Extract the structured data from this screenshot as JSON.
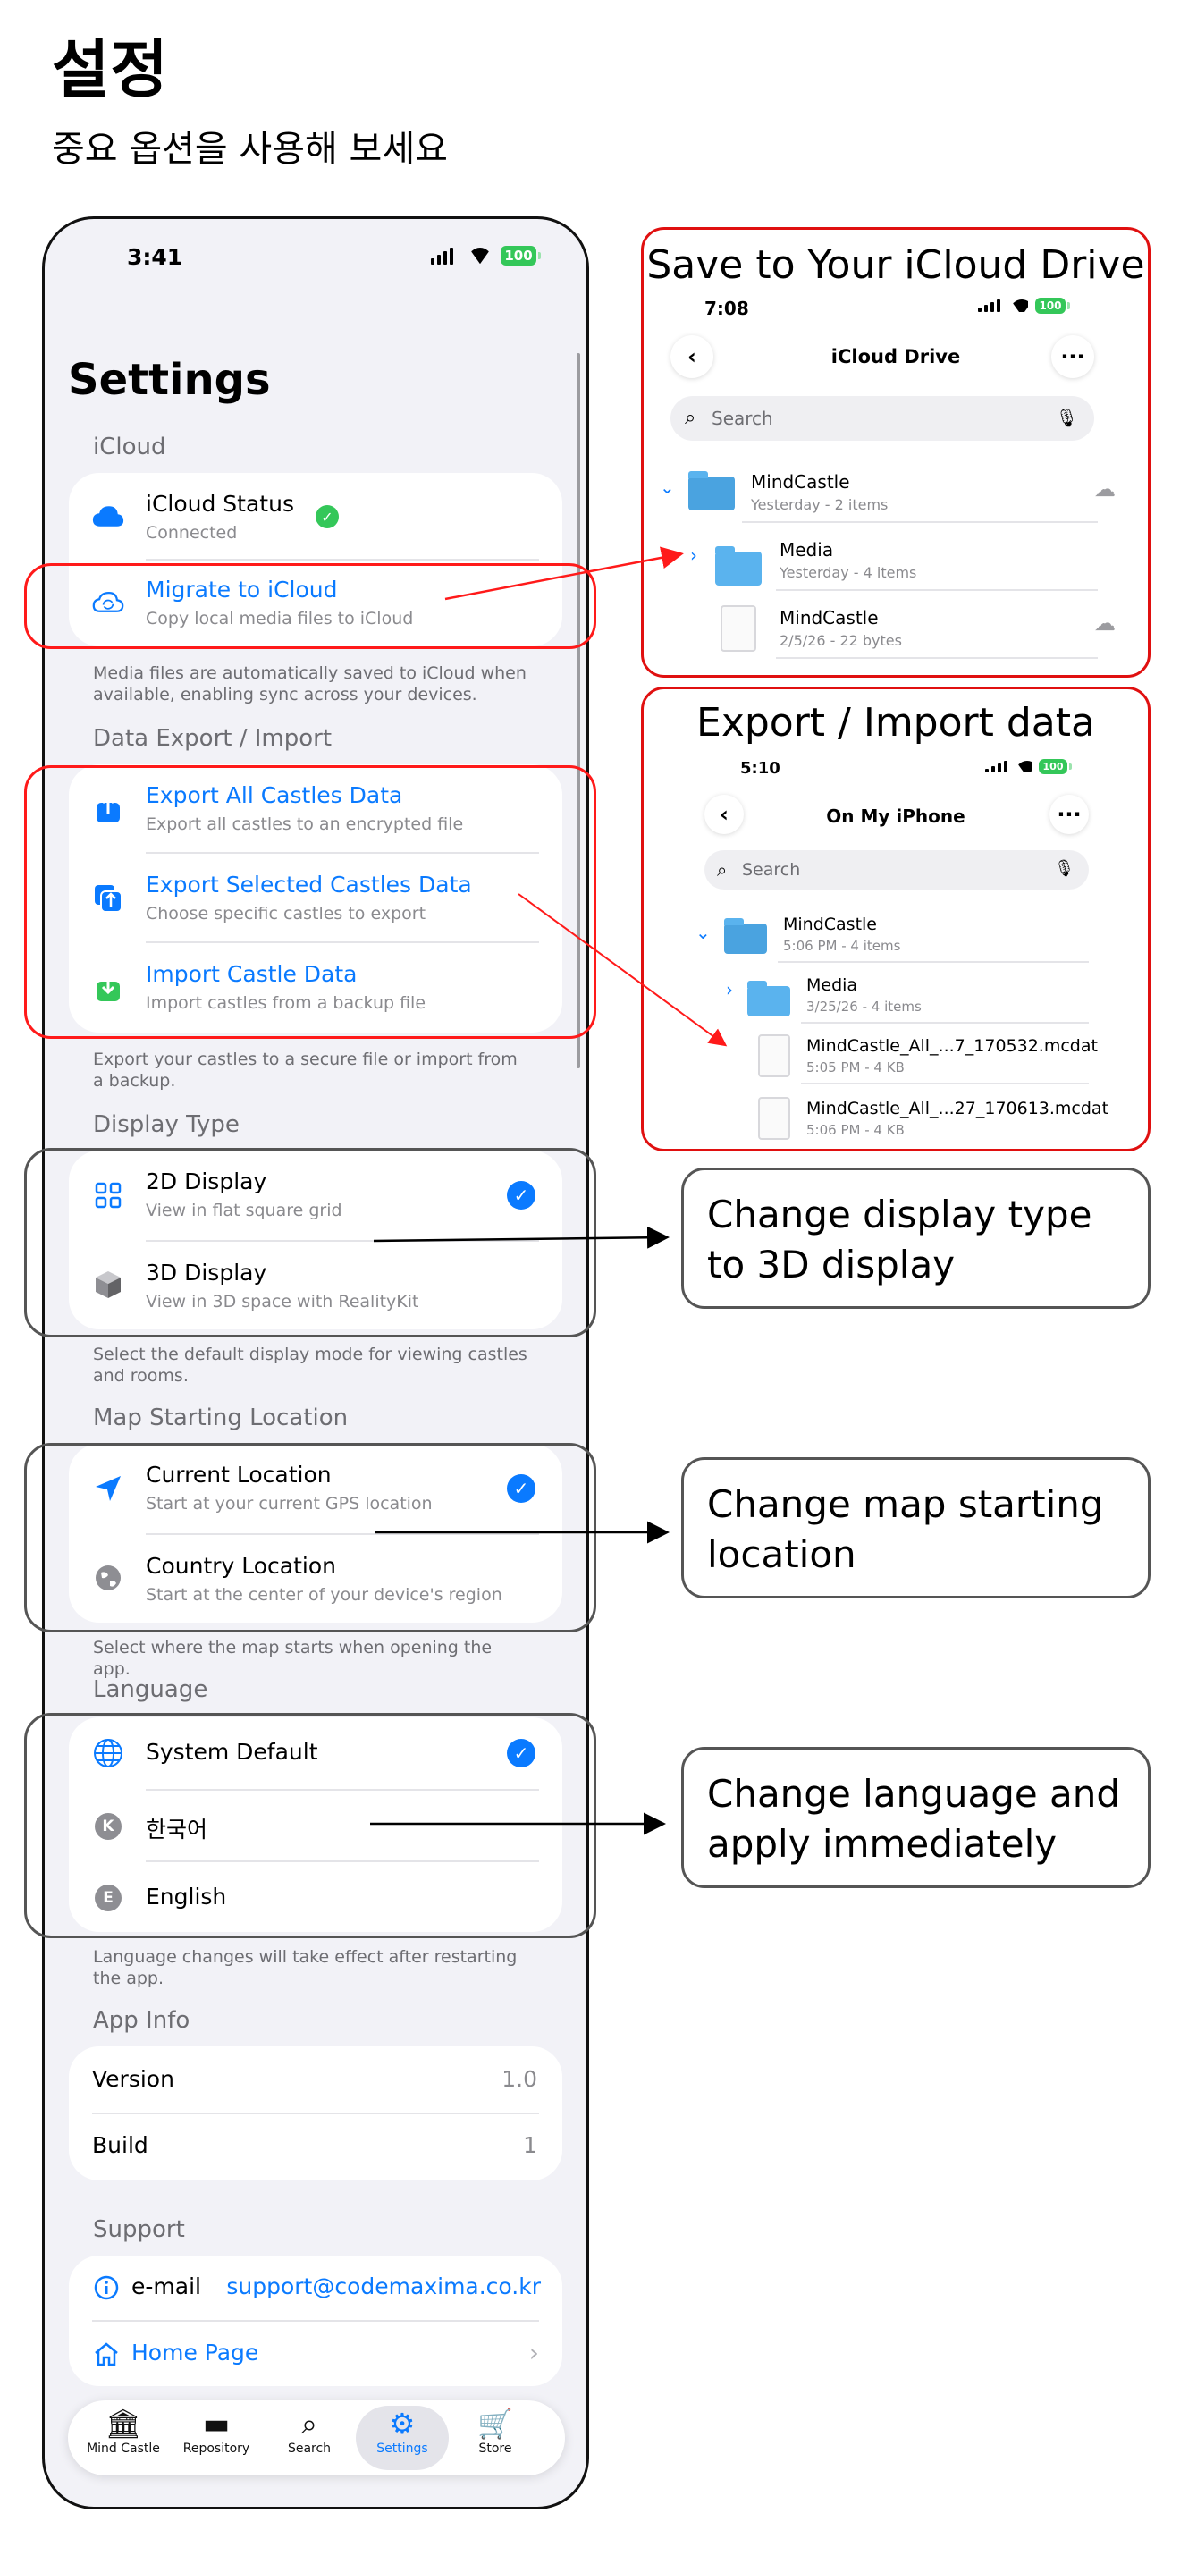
{
  "header": {
    "title": "설정",
    "subtitle": "중요 옵션을 사용해 보세요"
  },
  "phone": {
    "status": {
      "time": "3:41",
      "battery": "100"
    },
    "title": "Settings",
    "icloud": {
      "heading": "iCloud",
      "status_label": "iCloud Status",
      "status_value": "Connected",
      "migrate_label": "Migrate to iCloud",
      "migrate_sub": "Copy local media files to iCloud",
      "note": "Media files are automatically saved to iCloud when available, enabling sync across your devices."
    },
    "export": {
      "heading": "Data Export / Import",
      "items": [
        {
          "label": "Export All Castles Data",
          "sub": "Export all castles to an encrypted file"
        },
        {
          "label": "Export Selected Castles Data",
          "sub": "Choose specific castles to export"
        },
        {
          "label": "Import Castle Data",
          "sub": "Import castles from a backup file"
        }
      ],
      "note": "Export your castles to a secure file or import from a backup."
    },
    "display": {
      "heading": "Display Type",
      "items": [
        {
          "label": "2D Display",
          "sub": "View in flat square grid"
        },
        {
          "label": "3D Display",
          "sub": "View in 3D space with RealityKit"
        }
      ],
      "selected": "2D Display",
      "note": "Select the default display mode for viewing castles and rooms."
    },
    "map": {
      "heading": "Map Starting Location",
      "items": [
        {
          "label": "Current Location",
          "sub": "Start at your current GPS location"
        },
        {
          "label": "Country Location",
          "sub": "Start at the center of your device's region"
        }
      ],
      "selected": "Current Location",
      "note": "Select where the map starts when opening the app."
    },
    "language": {
      "heading": "Language",
      "items": [
        {
          "label": "System Default",
          "badge": ""
        },
        {
          "label": "한국어",
          "badge": "K"
        },
        {
          "label": "English",
          "badge": "E"
        }
      ],
      "selected": "System Default",
      "note": "Language changes will take effect after restarting the app."
    },
    "app_info": {
      "heading": "App Info",
      "version_label": "Version",
      "version_value": "1.0",
      "build_label": "Build",
      "build_value": "1"
    },
    "support": {
      "heading": "Support",
      "email_label": "e-mail",
      "email_value": "support@codemaxima.co.kr",
      "homepage_label": "Home Page"
    },
    "tabs": [
      {
        "label": "Mind Castle",
        "icon": "castle-icon"
      },
      {
        "label": "Repository",
        "icon": "folder-icon"
      },
      {
        "label": "Search",
        "icon": "search-icon"
      },
      {
        "label": "Settings",
        "icon": "gear-icon",
        "active": true
      },
      {
        "label": "Store",
        "icon": "cart-icon"
      }
    ]
  },
  "inset_icloud": {
    "title": "Save to Your iCloud Drive",
    "time": "7:08",
    "battery": "100",
    "nav_title": "iCloud Drive",
    "search_placeholder": "Search",
    "items": [
      {
        "name": "MindCastle",
        "meta": "Yesterday - 2 items"
      },
      {
        "name": "Media",
        "meta": "Yesterday - 4 items"
      },
      {
        "name": "MindCastle",
        "meta": "2/5/26 - 22 bytes"
      }
    ]
  },
  "inset_export": {
    "title": "Export / Import data",
    "time": "5:10",
    "battery": "100",
    "nav_title": "On My iPhone",
    "search_placeholder": "Search",
    "items": [
      {
        "name": "MindCastle",
        "meta": "5:06 PM - 4 items"
      },
      {
        "name": "Media",
        "meta": "3/25/26 - 4 items"
      },
      {
        "name": "MindCastle_All_...7_170532.mcdat",
        "meta": "5:05 PM - 4 KB"
      },
      {
        "name": "MindCastle_All_...27_170613.mcdat",
        "meta": "5:06 PM - 4 KB"
      }
    ]
  },
  "callouts": {
    "display": "Change display type to 3D display",
    "map": "Change map starting location",
    "language": "Change language and apply immediately"
  },
  "colors": {
    "accent": "#0a7aff",
    "success": "#34c759",
    "highlight_red": "#ff1a1a"
  }
}
